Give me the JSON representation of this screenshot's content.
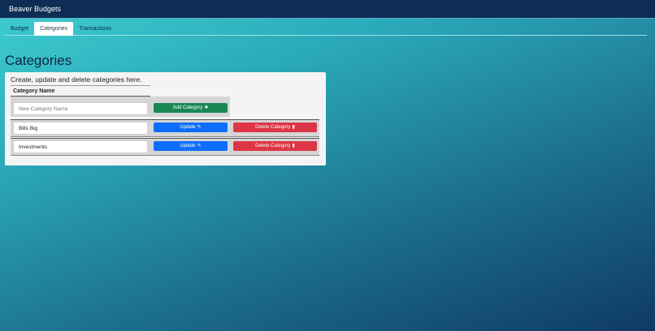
{
  "navbar": {
    "brand": "Beaver Budgets"
  },
  "tabs": [
    {
      "label": "Budget",
      "active": false
    },
    {
      "label": "Categories",
      "active": true
    },
    {
      "label": "Transactions",
      "active": false
    }
  ],
  "page": {
    "title": "Categories",
    "description": "Create, update and delete categories here."
  },
  "table": {
    "column_header": "Category Name",
    "new_category": {
      "placeholder": "New Category Name",
      "add_label": "Add Category"
    },
    "rows": [
      {
        "name": "Bills Big",
        "update_label": "Update",
        "delete_label": "Delete Category"
      },
      {
        "name": "Investments",
        "update_label": "Update",
        "delete_label": "Delete Category"
      }
    ]
  },
  "icons": {
    "add": "plus-icon",
    "update": "edit-icon",
    "delete": "trash-icon"
  },
  "colors": {
    "navbar": "#0d2d55",
    "add_button": "#198754",
    "update_button": "#0d6efd",
    "delete_button": "#dc3545"
  }
}
